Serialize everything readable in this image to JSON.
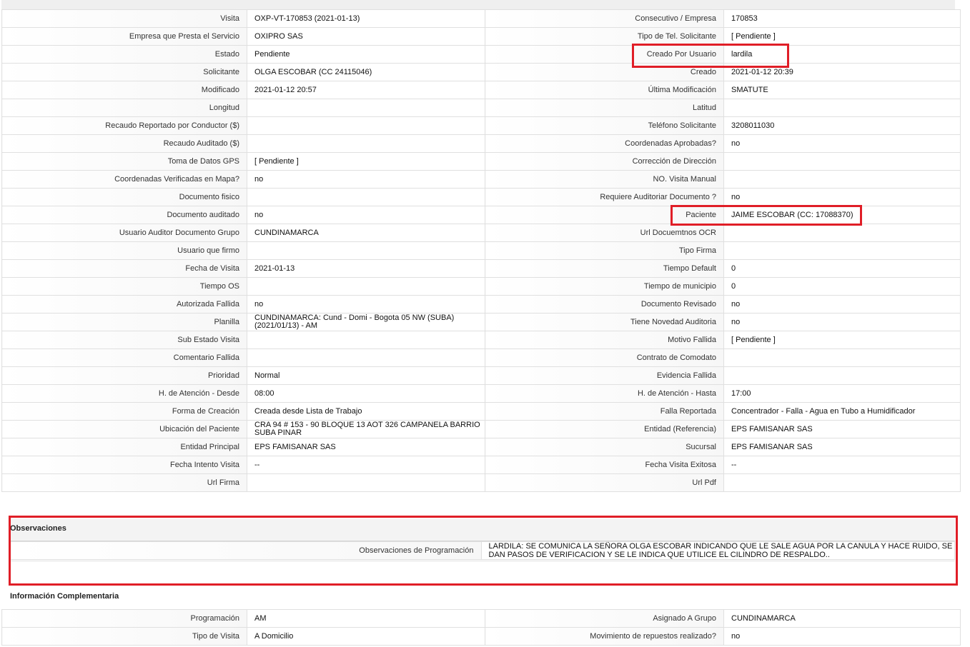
{
  "top_section": {
    "title": ""
  },
  "details": {
    "rows": [
      {
        "l1": "Visita",
        "v1": "OXP-VT-170853 (2021-01-13)",
        "l2": "Consecutivo / Empresa",
        "v2": "170853"
      },
      {
        "l1": "Empresa que Presta el Servicio",
        "v1": "OXIPRO SAS",
        "l2": "Tipo de Tel. Solicitante",
        "v2": "[ Pendiente ]"
      },
      {
        "l1": "Estado",
        "v1": "Pendiente",
        "l2": "Creado Por Usuario",
        "v2": "lardila"
      },
      {
        "l1": "Solicitante",
        "v1": "OLGA ESCOBAR (CC 24115046)",
        "l2": "Creado",
        "v2": "2021-01-12 20:39"
      },
      {
        "l1": "Modificado",
        "v1": "2021-01-12 20:57",
        "l2": "Última Modificación",
        "v2": " SMATUTE"
      },
      {
        "l1": "Longitud",
        "v1": "",
        "l2": "Latitud",
        "v2": ""
      },
      {
        "l1": "Recaudo Reportado por Conductor ($)",
        "v1": "",
        "l2": "Teléfono Solicitante",
        "v2": "3208011030"
      },
      {
        "l1": "Recaudo Auditado ($)",
        "v1": "",
        "l2": "Coordenadas Aprobadas?",
        "v2": " no"
      },
      {
        "l1": "Toma de Datos GPS",
        "v1": "[ Pendiente ]",
        "l2": "Corrección de Dirección",
        "v2": ""
      },
      {
        "l1": "Coordenadas Verificadas en Mapa?",
        "v1": " no",
        "l2": "NO. Visita Manual",
        "v2": ""
      },
      {
        "l1": "Documento fisico",
        "v1": "",
        "l2": "Requiere Auditoriar Documento ?",
        "v2": " no"
      },
      {
        "l1": "Documento auditado",
        "v1": " no",
        "l2": "Paciente",
        "v2": "JAIME ESCOBAR (CC: 17088370)"
      },
      {
        "l1": "Usuario Auditor Documento Grupo",
        "v1": "CUNDINAMARCA",
        "l2": "Url Docuemtnos OCR",
        "v2": ""
      },
      {
        "l1": "Usuario que firmo",
        "v1": "",
        "l2": "Tipo Firma",
        "v2": ""
      },
      {
        "l1": "Fecha de Visita",
        "v1": " 2021-01-13",
        "l2": "Tiempo Default",
        "v2": "0"
      },
      {
        "l1": "Tiempo OS",
        "v1": "",
        "l2": "Tiempo de municipio",
        "v2": "0"
      },
      {
        "l1": "Autorizada Fallida",
        "v1": " no",
        "l2": "Documento Revisado",
        "v2": " no"
      },
      {
        "l1": "Planilla",
        "v1": "CUNDINAMARCA: Cund - Domi - Bogota 05 NW (SUBA) (2021/01/13) - AM",
        "l2": "Tiene Novedad Auditoria",
        "v2": " no"
      },
      {
        "l1": "Sub Estado Visita",
        "v1": "",
        "l2": "Motivo Fallida",
        "v2": "[ Pendiente ]"
      },
      {
        "l1": "Comentario Fallida",
        "v1": "",
        "l2": "Contrato de Comodato",
        "v2": ""
      },
      {
        "l1": "Prioridad",
        "v1": "Normal",
        "l2": "Evidencia Fallida",
        "v2": ""
      },
      {
        "l1": "H. de Atención - Desde",
        "v1": "08:00",
        "l2": "H. de Atención - Hasta",
        "v2": "17:00"
      },
      {
        "l1": "Forma de Creación",
        "v1": "Creada desde Lista de Trabajo",
        "l2": "Falla Reportada",
        "v2": "Concentrador - Falla - Agua en Tubo a Humidificador"
      },
      {
        "l1": "Ubicación del Paciente",
        "v1": "CRA 94 # 153 - 90 BLOQUE 13 AOT 326 CAMPANELA BARRIO SUBA PINAR",
        "l2": "Entidad (Referencia)",
        "v2": "EPS FAMISANAR SAS"
      },
      {
        "l1": "Entidad Principal",
        "v1": "EPS FAMISANAR SAS",
        "l2": "Sucursal",
        "v2": "EPS FAMISANAR SAS"
      },
      {
        "l1": "Fecha Intento Visita",
        "v1": " --",
        "l2": "Fecha Visita Exitosa",
        "v2": " --"
      },
      {
        "l1": "Url Firma",
        "v1": "",
        "l2": "Url Pdf",
        "v2": ""
      }
    ]
  },
  "observaciones": {
    "title": "Observaciones",
    "label": "Observaciones de Programación",
    "value": "   LARDILA: SE COMUNICA LA SEÑORA OLGA ESCOBAR INDICANDO QUE LE SALE AGUA POR LA CANULA Y HACE RUIDO, SE DAN PASOS DE VERIFICACION Y SE LE INDICA QUE UTILICE EL CILINDRO DE RESPALDO.."
  },
  "complementaria": {
    "title": "Información Complementaria",
    "rows": [
      {
        "l1": "Programación",
        "v1": "AM",
        "l2": "Asignado A Grupo",
        "v2": "CUNDINAMARCA"
      },
      {
        "l1": "Tipo de Visita",
        "v1": "A Domicilio",
        "l2": "Movimiento de repuestos realizado?",
        "v2": " no"
      }
    ]
  },
  "highlight_color": "#e01e27"
}
